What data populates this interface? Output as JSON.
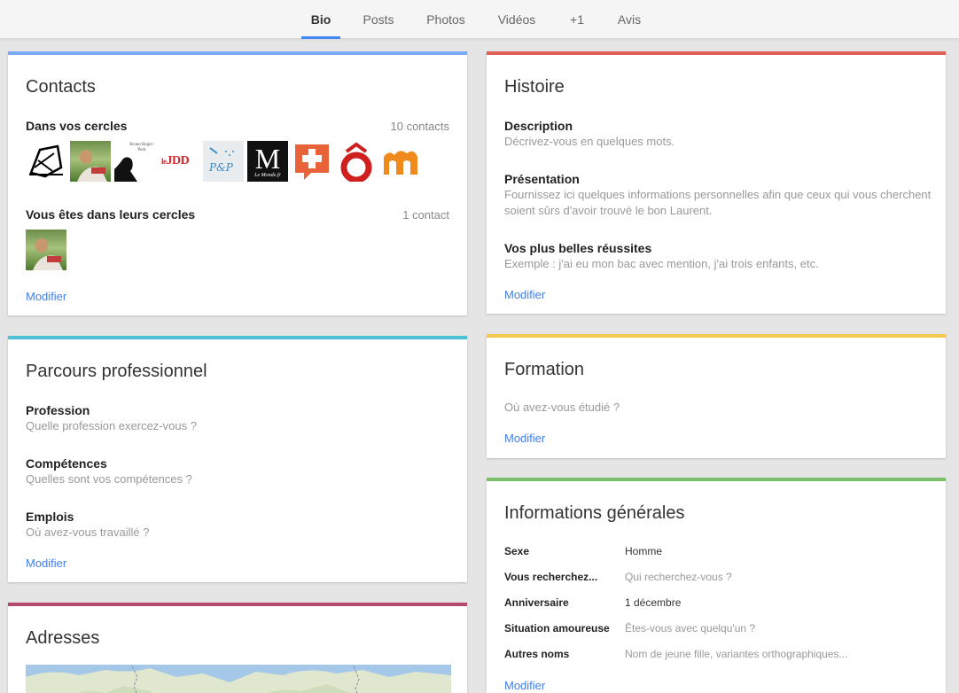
{
  "tabs": [
    {
      "label": "Bio",
      "active": true
    },
    {
      "label": "Posts",
      "active": false
    },
    {
      "label": "Photos",
      "active": false
    },
    {
      "label": "Vidéos",
      "active": false
    },
    {
      "label": "+1",
      "active": false
    },
    {
      "label": "Avis",
      "active": false
    }
  ],
  "colors": {
    "contacts": "#7baaf7",
    "histoire": "#e06055",
    "parcours": "#4ec1d6",
    "formation": "#f2c94c",
    "infos": "#7cc06c",
    "adresses": "#b5486d",
    "link": "#427fed",
    "tab_accent": "#4285f4"
  },
  "contacts": {
    "title": "Contacts",
    "in_circles_label": "Dans vos cercles",
    "in_circles_count": "10 contacts",
    "in_circles_avatars": [
      "drawing-logo",
      "person-photo",
      "book-cover",
      "lejdd-logo",
      "pp-logo",
      "lemonde-logo",
      "plus-logo",
      "o-logo",
      "m-logo"
    ],
    "their_circles_label": "Vous êtes dans leurs cercles",
    "their_circles_count": "1 contact",
    "their_circles_avatars": [
      "person-photo"
    ],
    "avatar_text": {
      "book": "Bruno Roger-Petit",
      "lejdd": "JDD",
      "pp": "P&P",
      "lemonde": "M",
      "lemonde_caption": "Le Monde.fr"
    },
    "edit": "Modifier"
  },
  "histoire": {
    "title": "Histoire",
    "items": [
      {
        "label": "Description",
        "hint": "Décrivez-vous en quelques mots."
      },
      {
        "label": "Présentation",
        "hint": "Fournissez ici quelques informations personnelles afin que ceux qui vous cherchent soient sûrs d'avoir trouvé le bon Laurent."
      },
      {
        "label": "Vos plus belles réussites",
        "hint": "Exemple : j'ai eu mon bac avec mention, j'ai trois enfants, etc."
      }
    ],
    "edit": "Modifier"
  },
  "parcours": {
    "title": "Parcours professionnel",
    "items": [
      {
        "label": "Profession",
        "hint": "Quelle profession exercez-vous ?"
      },
      {
        "label": "Compétences",
        "hint": "Quelles sont vos compétences ?"
      },
      {
        "label": "Emplois",
        "hint": "Où avez-vous travaillé ?"
      }
    ],
    "edit": "Modifier"
  },
  "formation": {
    "title": "Formation",
    "hint": "Où avez-vous étudié ?",
    "edit": "Modifier"
  },
  "infos": {
    "title": "Informations générales",
    "rows": [
      {
        "label": "Sexe",
        "value": "Homme",
        "placeholder": false
      },
      {
        "label": "Vous recherchez...",
        "value": "Qui recherchez-vous ?",
        "placeholder": true
      },
      {
        "label": "Anniversaire",
        "value": "1 décembre",
        "placeholder": false
      },
      {
        "label": "Situation amoureuse",
        "value": "Êtes-vous avec quelqu'un ?",
        "placeholder": true
      },
      {
        "label": "Autres noms",
        "value": "Nom de jeune fille, variantes orthographiques...",
        "placeholder": true
      }
    ],
    "edit": "Modifier"
  },
  "adresses": {
    "title": "Adresses"
  }
}
